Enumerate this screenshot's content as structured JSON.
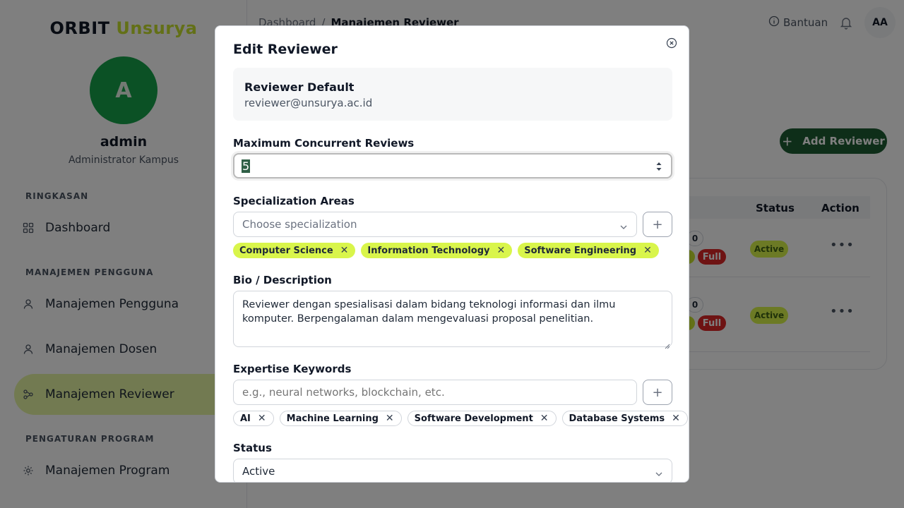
{
  "brand": {
    "part1": "ORBIT",
    "part2": "Unsurya"
  },
  "profile": {
    "initial": "A",
    "name": "admin",
    "role": "Administrator Kampus"
  },
  "sidebar": {
    "sections": [
      "RINGKASAN",
      "MANAJEMEN PENGGUNA",
      "PENGATURAN PROGRAM"
    ],
    "items": [
      {
        "label": "Dashboard",
        "icon": "grid-icon"
      },
      {
        "label": "Manajemen Pengguna",
        "icon": "user-icon"
      },
      {
        "label": "Manajemen Dosen",
        "icon": "user-icon"
      },
      {
        "label": "Manajemen Reviewer",
        "icon": "users-network-icon",
        "active": true
      },
      {
        "label": "Manajemen Program",
        "icon": "gear-icon"
      }
    ]
  },
  "header": {
    "breadcrumb": [
      "Dashboard",
      "Manajemen Reviewer"
    ],
    "help": "Bantuan",
    "user_initials": "AA"
  },
  "page": {
    "add_button": "Add Reviewer",
    "table_headers": [
      "Status",
      "Action"
    ],
    "rows": [
      {
        "count": "0",
        "capacity": "Full",
        "status": "Active"
      },
      {
        "count": "0",
        "capacity": "Full",
        "status": "Active"
      }
    ]
  },
  "modal": {
    "title": "Edit Reviewer",
    "reviewer": {
      "name": "Reviewer Default",
      "email": "reviewer@unsurya.ac.id"
    },
    "max_reviews": {
      "label": "Maximum Concurrent Reviews",
      "value": "5"
    },
    "specialization": {
      "label": "Specialization Areas",
      "placeholder": "Choose specialization",
      "tags": [
        "Computer Science",
        "Information Technology",
        "Software Engineering"
      ]
    },
    "bio": {
      "label": "Bio / Description",
      "value": "Reviewer dengan spesialisasi dalam bidang teknologi informasi dan ilmu komputer. Berpengalaman dalam mengevaluasi proposal penelitian."
    },
    "keywords": {
      "label": "Expertise Keywords",
      "placeholder": "e.g., neural networks, blockchain, etc.",
      "tags": [
        "AI",
        "Machine Learning",
        "Software Development",
        "Database Systems"
      ]
    },
    "status": {
      "label": "Status",
      "value": "Active"
    }
  },
  "colors": {
    "accent_lime": "#d9f54b",
    "primary_green": "#1d5c33",
    "avatar_green": "#16a34a",
    "danger": "#dc2626"
  }
}
